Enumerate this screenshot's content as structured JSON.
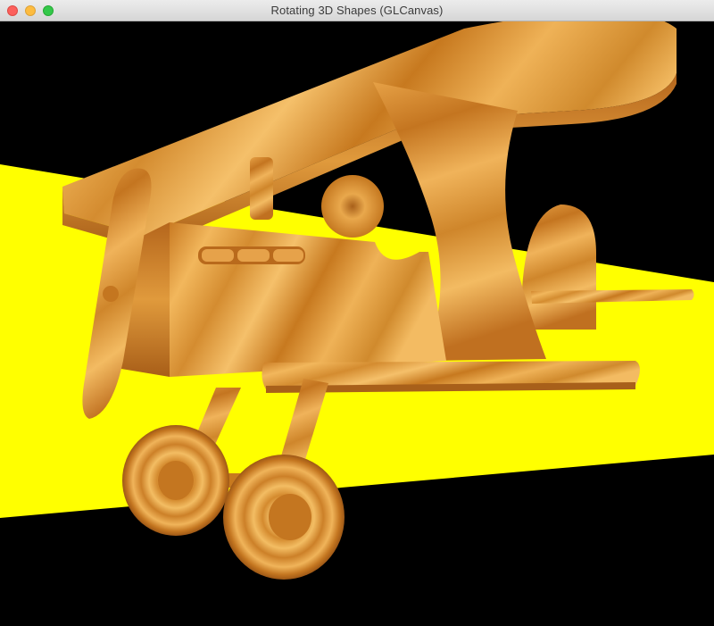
{
  "window": {
    "title": "Rotating 3D Shapes (GLCanvas)"
  },
  "controls": {
    "close": "close-icon",
    "minimize": "minimize-icon",
    "zoom": "zoom-icon"
  },
  "scene": {
    "background_color": "#000000",
    "floor_color": "#ffff00",
    "wood_light": "#f0b45a",
    "wood_mid": "#d8902e",
    "wood_dark": "#a8601a",
    "object": "wooden-biplane"
  }
}
